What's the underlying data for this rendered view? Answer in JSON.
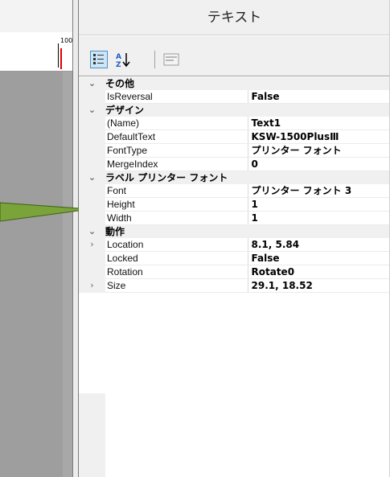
{
  "panel": {
    "title": "テキスト"
  },
  "ruler": {
    "label": "100"
  },
  "toolbar": {
    "categorized_icon": "categorized-view-icon",
    "alphabetical_icon": "alphabetical-sort-icon",
    "pages_icon": "property-pages-icon"
  },
  "grid": {
    "cat_other": "その他",
    "cat_design": "デザイン",
    "cat_label_font": "ラベル プリンター フォント",
    "cat_behavior": "動作",
    "rows": {
      "isreversal": {
        "name": "IsReversal",
        "value": "False"
      },
      "name": {
        "name": "(Name)",
        "value": "Text1"
      },
      "defaulttext": {
        "name": "DefaultText",
        "value": "KSW-1500PlusⅢ"
      },
      "fonttype": {
        "name": "FontType",
        "value": "プリンター フォント"
      },
      "mergeindex": {
        "name": "MergeIndex",
        "value": "0"
      },
      "font": {
        "name": "Font",
        "value": "プリンター フォント 3"
      },
      "height": {
        "name": "Height",
        "value": "1"
      },
      "width": {
        "name": "Width",
        "value": "1"
      },
      "location": {
        "name": "Location",
        "value": "8.1, 5.84"
      },
      "locked": {
        "name": "Locked",
        "value": "False"
      },
      "rotation": {
        "name": "Rotation",
        "value": "Rotate0"
      },
      "size": {
        "name": "Size",
        "value": "29.1, 18.52"
      }
    }
  },
  "colors": {
    "callout": "#7aa33a",
    "selected_button": "#cde6f7",
    "ruler_marker": "#e00000"
  }
}
